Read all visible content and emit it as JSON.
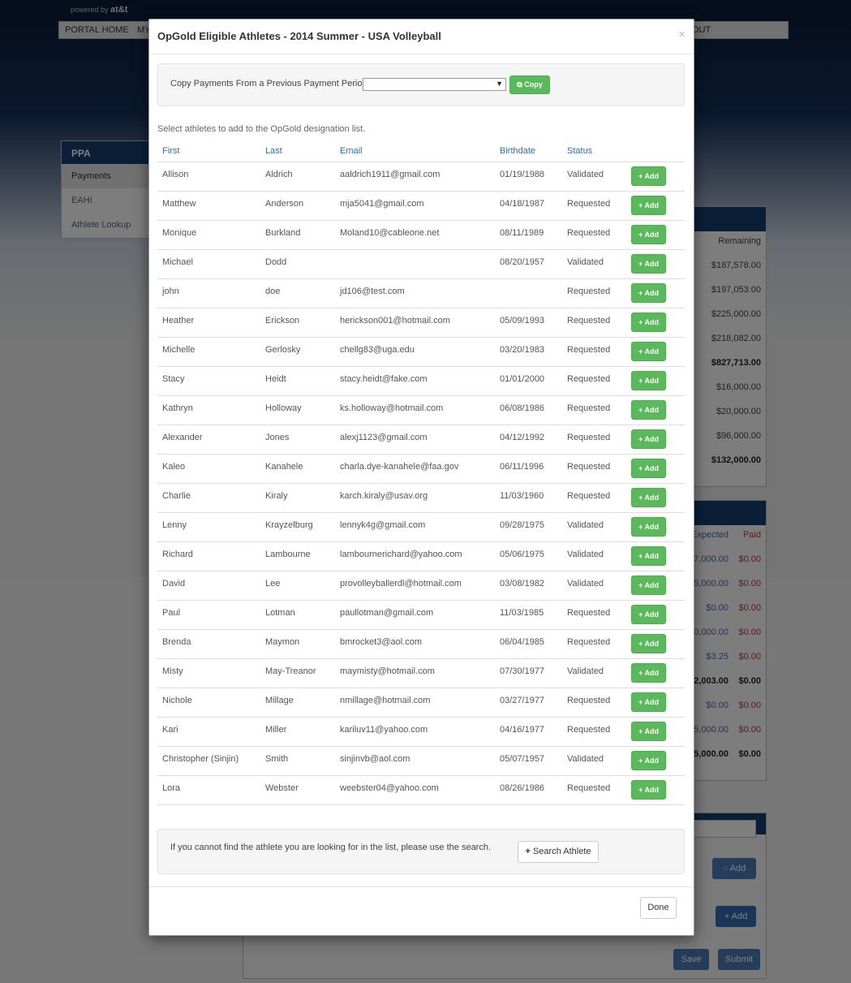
{
  "background": {
    "powered_by": "powered by",
    "brand": "at&t",
    "nav": {
      "portal_home": "PORTAL HOME",
      "my": "MY",
      "logout": "OUT"
    },
    "sidebar": {
      "header": "PPA",
      "items": [
        "Payments",
        "EAHI",
        "Athlete Lookup"
      ]
    },
    "panel1": {
      "col_header": "Remaining",
      "values": [
        "$187,578.00",
        "$197,053.00",
        "$225,000.00",
        "$218,082.00",
        "$827,713.00",
        "$16,000.00",
        "$20,000.00",
        "$96,000.00",
        "$132,000.00"
      ]
    },
    "panel2": {
      "col_expected": "Expected",
      "col_paid": "Paid",
      "expected": [
        "7,000.00",
        "5,000.00",
        "$0.00",
        "0,000.00",
        "$3.25",
        "2,003.00",
        "$0.00",
        "5,000.00",
        "5,000.00"
      ],
      "paid": [
        "$0.00",
        "$0.00",
        "$0.00",
        "$0.00",
        "$0.00",
        "$0.00",
        "$0.00",
        "$0.00",
        "$0.00"
      ]
    },
    "lower": {
      "add1": "Add",
      "add2": "Add",
      "save": "Save",
      "submit": "Submit"
    }
  },
  "modal": {
    "title": "OpGold Eligible Athletes - 2014 Summer - USA Volleyball",
    "close": "×",
    "copy_label": "Copy Payments From a Previous Payment Period:",
    "copy_select_value": "",
    "copy_button": "Copy",
    "intro": "Select athletes to add to the OpGold designation list.",
    "columns": {
      "first": "First",
      "last": "Last",
      "email": "Email",
      "birthdate": "Birthdate",
      "status": "Status"
    },
    "add_label": "Add",
    "athletes": [
      {
        "first": "Allison",
        "last": "Aldrich",
        "email": "aaldrich1911@gmail.com",
        "birthdate": "01/19/1988",
        "status": "Validated"
      },
      {
        "first": "Matthew",
        "last": "Anderson",
        "email": "mja5041@gmail.com",
        "birthdate": "04/18/1987",
        "status": "Requested"
      },
      {
        "first": "Monique",
        "last": "Burkland",
        "email": "Moland10@cableone.net",
        "birthdate": "08/11/1989",
        "status": "Requested"
      },
      {
        "first": "Michael",
        "last": "Dodd",
        "email": "",
        "birthdate": "08/20/1957",
        "status": "Validated"
      },
      {
        "first": "john",
        "last": "doe",
        "email": "jd106@test.com",
        "birthdate": "",
        "status": "Requested"
      },
      {
        "first": "Heather",
        "last": "Erickson",
        "email": "herickson001@hotmail.com",
        "birthdate": "05/09/1993",
        "status": "Requested"
      },
      {
        "first": "Michelle",
        "last": "Gerlosky",
        "email": "chellg83@uga.edu",
        "birthdate": "03/20/1983",
        "status": "Requested"
      },
      {
        "first": "Stacy",
        "last": "Heidt",
        "email": "stacy.heidt@fake.com",
        "birthdate": "01/01/2000",
        "status": "Requested"
      },
      {
        "first": "Kathryn",
        "last": "Holloway",
        "email": "ks.holloway@hotmail.com",
        "birthdate": "06/08/1986",
        "status": "Requested"
      },
      {
        "first": "Alexander",
        "last": "Jones",
        "email": "alexj1123@gmail.com",
        "birthdate": "04/12/1992",
        "status": "Requested"
      },
      {
        "first": "Kaleo",
        "last": "Kanahele",
        "email": "charla.dye-kanahele@faa.gov",
        "birthdate": "06/11/1996",
        "status": "Requested"
      },
      {
        "first": "Charlie",
        "last": "Kiraly",
        "email": "karch.kiraly@usav.org",
        "birthdate": "11/03/1960",
        "status": "Requested"
      },
      {
        "first": "Lenny",
        "last": "Krayzelburg",
        "email": "lennyk4g@gmail.com",
        "birthdate": "09/28/1975",
        "status": "Validated"
      },
      {
        "first": "Richard",
        "last": "Lambourne",
        "email": "lambournerichard@yahoo.com",
        "birthdate": "05/06/1975",
        "status": "Validated"
      },
      {
        "first": "David",
        "last": "Lee",
        "email": "provolleyballerdl@hotmail.com",
        "birthdate": "03/08/1982",
        "status": "Validated"
      },
      {
        "first": "Paul",
        "last": "Lotman",
        "email": "paullotman@gmail.com",
        "birthdate": "11/03/1985",
        "status": "Requested"
      },
      {
        "first": "Brenda",
        "last": "Maymon",
        "email": "bmrocket3@aol.com",
        "birthdate": "06/04/1985",
        "status": "Requested"
      },
      {
        "first": "Misty",
        "last": "May-Treanor",
        "email": "maymisty@hotmail.com",
        "birthdate": "07/30/1977",
        "status": "Validated"
      },
      {
        "first": "Nichole",
        "last": "Millage",
        "email": "nmillage@hotmail.com",
        "birthdate": "03/27/1977",
        "status": "Requested"
      },
      {
        "first": "Kari",
        "last": "Miller",
        "email": "kariluv11@yahoo.com",
        "birthdate": "04/16/1977",
        "status": "Requested"
      },
      {
        "first": "Christopher (Sinjin)",
        "last": "Smith",
        "email": "sinjinvb@aol.com",
        "birthdate": "05/07/1957",
        "status": "Validated"
      },
      {
        "first": "Lora",
        "last": "Webster",
        "email": "weebster04@yahoo.com",
        "birthdate": "08/26/1986",
        "status": "Requested"
      }
    ],
    "search_hint": "If you cannot find the athlete you are looking for in the list, please use the search.",
    "search_button": "Search Athlete",
    "done_button": "Done"
  },
  "icons": {
    "copy": "copy-icon",
    "plus": "plus-icon",
    "close": "close-icon",
    "dropdown": "caret-down-icon"
  },
  "colors": {
    "primary_green": "#5cb85c",
    "header_link": "#2a6fb0",
    "navy": "#143e6e"
  }
}
